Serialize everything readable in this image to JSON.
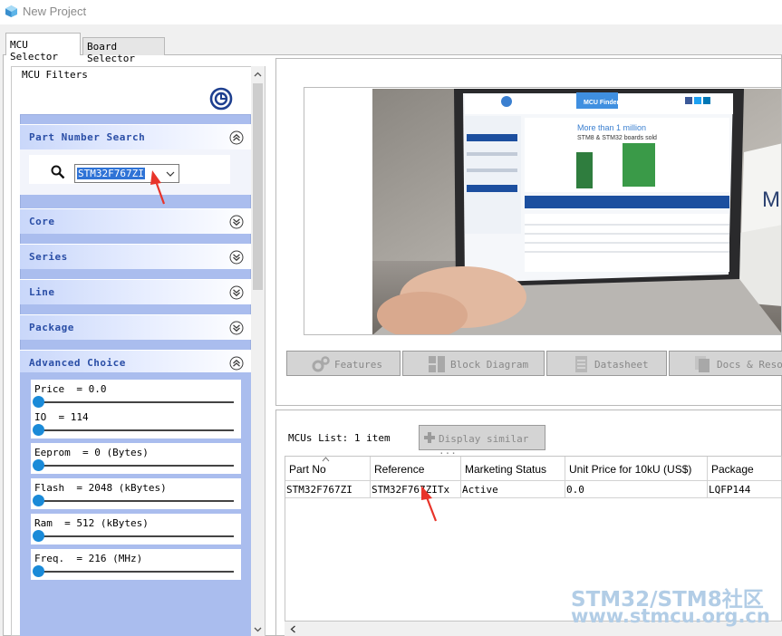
{
  "window": {
    "title": "New Project"
  },
  "tabs": [
    {
      "label": "MCU Selector"
    },
    {
      "label": "Board Selector"
    }
  ],
  "filters": {
    "legend": "MCU Filters",
    "part_number": {
      "header": "Part Number Search",
      "value": "STM32F767ZI"
    },
    "sections": [
      {
        "label": "Core"
      },
      {
        "label": "Series"
      },
      {
        "label": "Line"
      },
      {
        "label": "Package"
      }
    ],
    "advanced": {
      "header": "Advanced Choice",
      "sliders": [
        {
          "label": "Price  = 0.0"
        },
        {
          "label": "IO  = 114"
        },
        {
          "label": "Eeprom  = 0 (Bytes)"
        },
        {
          "label": "Flash  = 2048 (kBytes)"
        },
        {
          "label": "Ram  = 512 (kBytes)"
        },
        {
          "label": "Freq.  = 216 (MHz)"
        }
      ]
    }
  },
  "promo": {
    "logo_text": "MCU Finder",
    "headline": "More than 1 million",
    "subline": "STM8 & STM32 boards sold",
    "side_text": "M"
  },
  "actions": [
    {
      "label": "Features"
    },
    {
      "label": "Block Diagram"
    },
    {
      "label": "Datasheet"
    },
    {
      "label": "Docs & Resou"
    }
  ],
  "mcu_list": {
    "label": "MCUs List: 1 item",
    "display_similar": "Display similar ...",
    "columns": [
      "Part No",
      "Reference",
      "Marketing Status",
      "Unit Price for 10kU (US$)",
      "Package"
    ],
    "rows": [
      [
        "STM32F767ZI",
        "STM32F767ZITx",
        "Active",
        "0.0",
        "LQFP144"
      ]
    ]
  },
  "watermark": {
    "line1": "STM32/STM8社区",
    "line2": "www.stmcu.org.cn"
  },
  "colors": {
    "accent_blue": "#2a4ea6",
    "filter_bg": "#aabdee",
    "selection": "#2f73d6",
    "slider_thumb": "#1a8ad8",
    "arrow": "#e8342a"
  }
}
